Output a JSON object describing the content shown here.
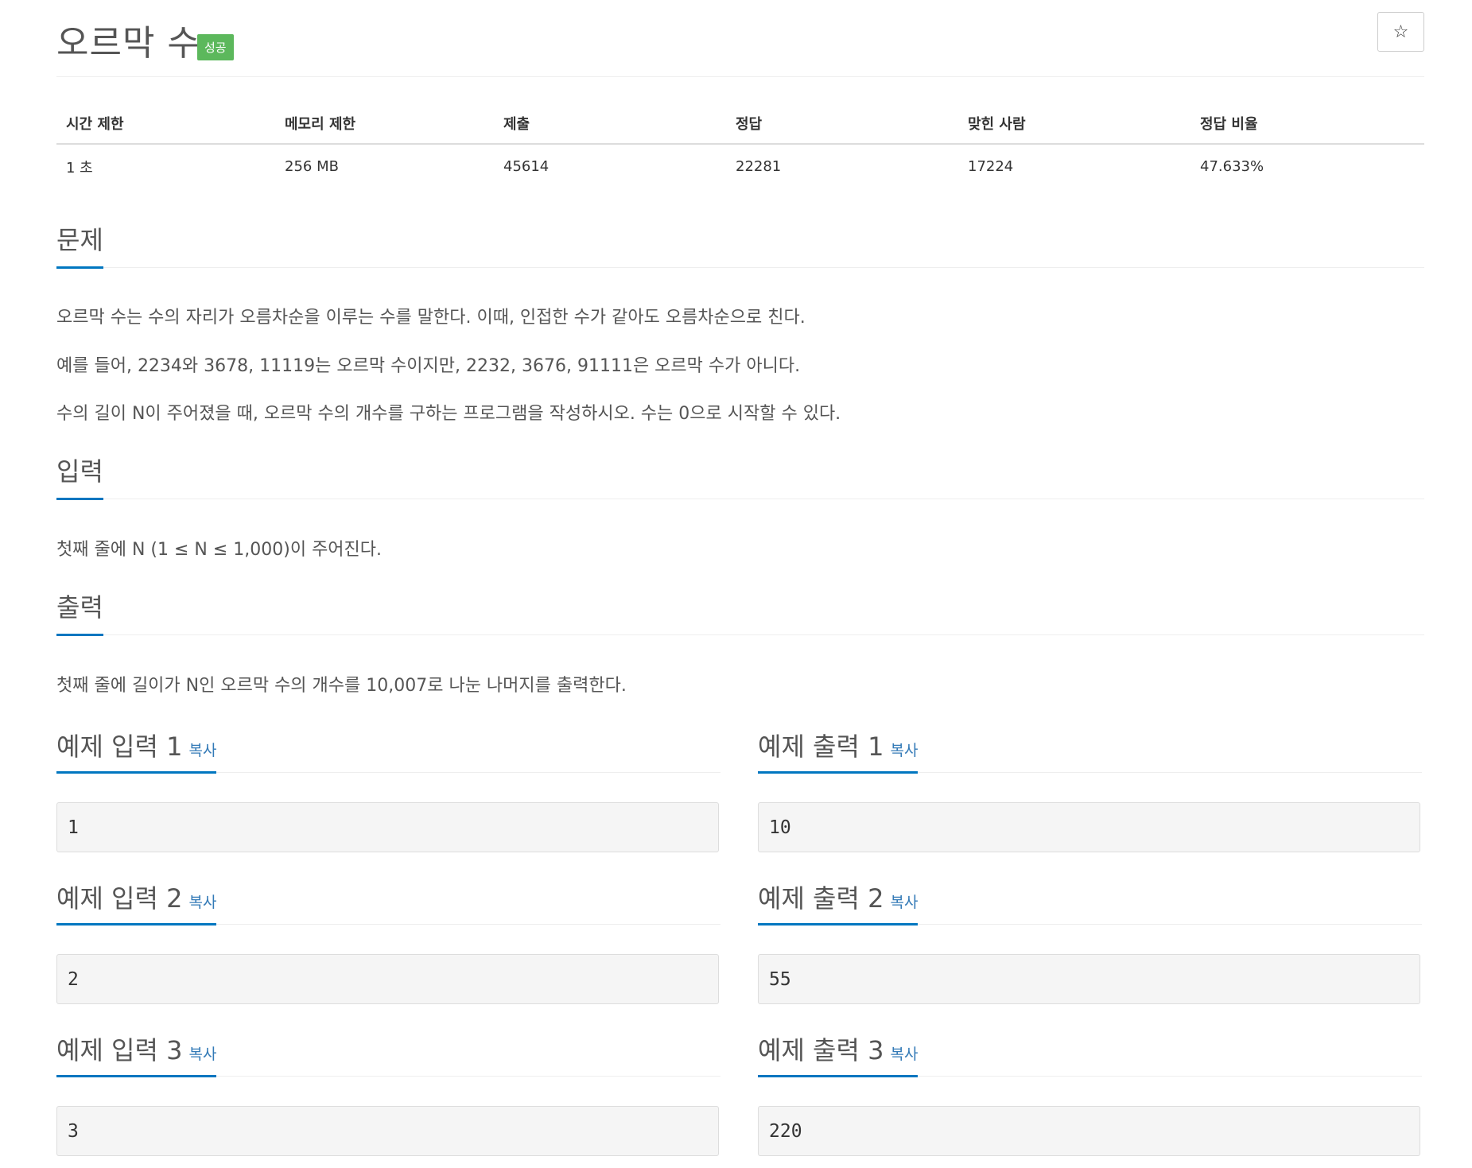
{
  "problem": {
    "title": "오르막 수",
    "status_badge": "성공"
  },
  "stats": {
    "headers": [
      "시간 제한",
      "메모리 제한",
      "제출",
      "정답",
      "맞힌 사람",
      "정답 비율"
    ],
    "values": [
      "1 초",
      "256 MB",
      "45614",
      "22281",
      "17224",
      "47.633%"
    ]
  },
  "sections": {
    "description": {
      "heading": "문제",
      "paragraphs": [
        "오르막 수는 수의 자리가 오름차순을 이루는 수를 말한다. 이때, 인접한 수가 같아도 오름차순으로 친다.",
        "예를 들어, 2234와 3678, 11119는 오르막 수이지만, 2232, 3676, 91111은 오르막 수가 아니다.",
        "수의 길이 N이 주어졌을 때, 오르막 수의 개수를 구하는 프로그램을 작성하시오. 수는 0으로 시작할 수 있다."
      ]
    },
    "input": {
      "heading": "입력",
      "text": "첫째 줄에 N (1 ≤ N ≤ 1,000)이 주어진다."
    },
    "output": {
      "heading": "출력",
      "text": "첫째 줄에 길이가 N인 오르막 수의 개수를 10,007로 나눈 나머지를 출력한다."
    }
  },
  "examples": [
    {
      "input_heading": "예제 입력 1",
      "output_heading": "예제 출력 1",
      "input": "1",
      "output": "10"
    },
    {
      "input_heading": "예제 입력 2",
      "output_heading": "예제 출력 2",
      "input": "2",
      "output": "55"
    },
    {
      "input_heading": "예제 입력 3",
      "output_heading": "예제 출력 3",
      "input": "3",
      "output": "220"
    }
  ],
  "copy_label": "복사",
  "icons": {
    "favorite": "star-icon"
  },
  "colors": {
    "accent": "#0076c0",
    "success": "#5cb85c",
    "link": "#337ab7"
  }
}
